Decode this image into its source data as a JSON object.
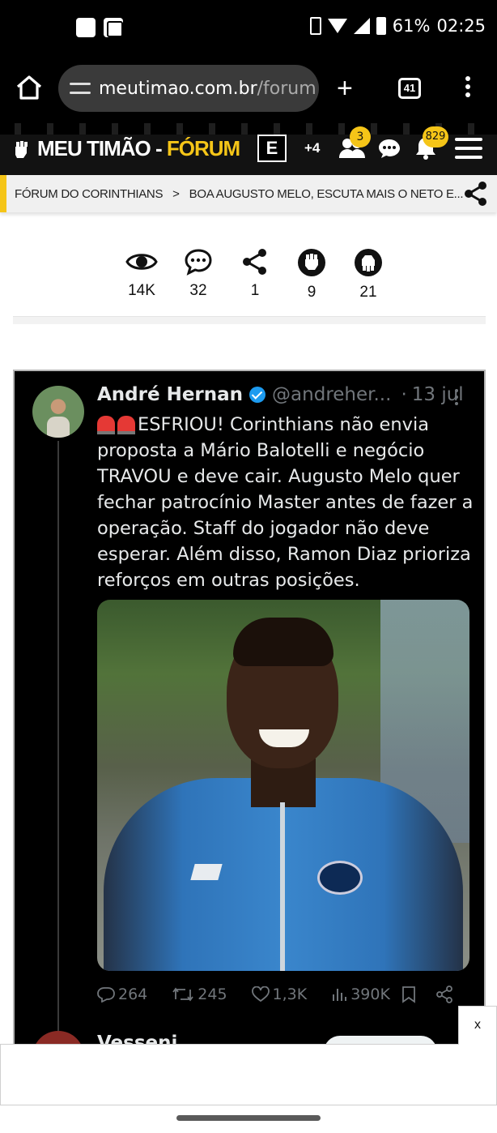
{
  "status_bar": {
    "battery": "61%",
    "time": "02:25"
  },
  "browser": {
    "url_domain": "meutimao.com.br",
    "url_path": "/forum",
    "tab_count": "41"
  },
  "site": {
    "logo_main": "MEU TIMÃO",
    "logo_dash": " - ",
    "logo_forum": "FÓRUM",
    "badge_e": "E",
    "plus_count": "+4",
    "friends_badge": "3",
    "notifications_badge": "829",
    "accent_color": "#f5c518"
  },
  "breadcrumb": {
    "section": "FÓRUM DO CORINTHIANS",
    "separator": ">",
    "topic": "BOA AUGUSTO MELO, ESCUTA MAIS O NETO E..."
  },
  "stats": {
    "views": "14K",
    "comments": "32",
    "shares": "1",
    "likes": "9",
    "dislikes": "21"
  },
  "tweet": {
    "author": "André Hernan",
    "handle": "@andreher...",
    "dot": "·",
    "date": "13 jul",
    "text": "ESFRIOU! Corinthians não envia proposta a Mário Balotelli e negócio TRAVOU e deve cair. Augusto Melo quer fechar patrocínio Master antes de fazer a operação. Staff do jogador não deve esperar. Além disso, Ramon Diaz prioriza reforços em outras posições.",
    "replies": "264",
    "retweets": "245",
    "likes": "1,3K",
    "views": "390K",
    "next_author": "Vesseni"
  },
  "ad": {
    "close_label": "x"
  }
}
